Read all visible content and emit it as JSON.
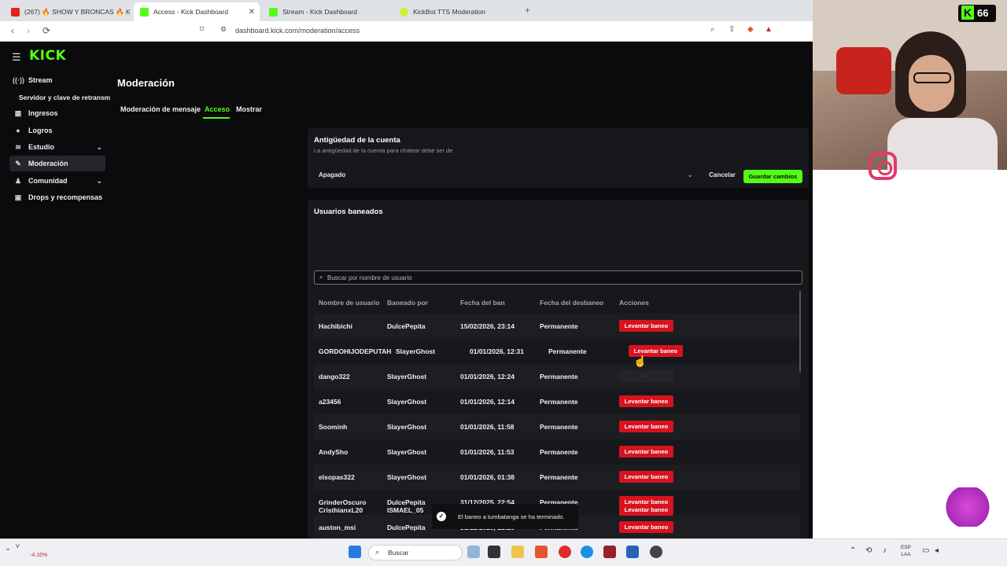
{
  "browser": {
    "tabs": [
      {
        "label": "(267) 🔥 SHOW Y BRONCAS 🔥 KINGT",
        "active": false
      },
      {
        "label": "Access - Kick Dashboard",
        "active": true
      },
      {
        "label": "Stream - Kick Dashboard",
        "active": false
      },
      {
        "label": "KickBot TTS Moderation",
        "active": false
      }
    ],
    "url": "dashboard.kick.com/moderation/access"
  },
  "sidebar": {
    "items": [
      {
        "label": "Stream",
        "icon": "broadcast-icon"
      },
      {
        "label": "Servidor y clave de retransm",
        "icon": ""
      },
      {
        "label": "Ingresos",
        "icon": "chart-icon"
      },
      {
        "label": "Logros",
        "icon": "trophy-icon"
      },
      {
        "label": "Estudio",
        "icon": "layers-icon"
      },
      {
        "label": "Moderación",
        "icon": "wrench-icon"
      },
      {
        "label": "Comunidad",
        "icon": "users-icon"
      },
      {
        "label": "Drops y recompensas",
        "icon": "gift-icon"
      }
    ]
  },
  "page": {
    "title": "Moderación",
    "tabs": [
      "Moderación de mensaje",
      "Acceso",
      "Mostrar"
    ]
  },
  "account_age": {
    "title": "Antigüedad de la cuenta",
    "subtitle": "La antigüedad de la cuenta para chatear debe ser de",
    "value": "Apagado",
    "cancel": "Cancelar",
    "save": "Guardar cambios"
  },
  "bans": {
    "title": "Usuarios baneados",
    "search_placeholder": "Buscar por nombre de usuario",
    "columns": [
      "Nombre de usuario",
      "Baneado por",
      "Fecha del ban",
      "Fecha del desbaneo",
      "Acciones"
    ],
    "unban_label": "Levantar baneo",
    "rows": [
      {
        "user": "Hachibichi",
        "by": "DulcePepita",
        "date": "15/02/2026, 23:14",
        "until": "Permanente"
      },
      {
        "user": "GORDOHIJODEPUTAH",
        "by": "SlayerGhost",
        "date": "01/01/2026, 12:31",
        "until": "Permanente"
      },
      {
        "user": "dango322",
        "by": "SlayerGhost",
        "date": "01/01/2026, 12:24",
        "until": "Permanente"
      },
      {
        "user": "a23456",
        "by": "SlayerGhost",
        "date": "01/01/2026, 12:14",
        "until": "Permanente"
      },
      {
        "user": "Soominh",
        "by": "SlayerGhost",
        "date": "01/01/2026, 11:58",
        "until": "Permanente"
      },
      {
        "user": "AndySho",
        "by": "SlayerGhost",
        "date": "01/01/2026, 11:53",
        "until": "Permanente"
      },
      {
        "user": "elsopas322",
        "by": "SlayerGhost",
        "date": "01/01/2026, 01:38",
        "until": "Permanente"
      },
      {
        "user": "GrinderOscuro",
        "by": "DulcePepita",
        "date": "31/12/2025, 22:54",
        "until": "Permanente"
      },
      {
        "user": "auston_msi",
        "by": "DulcePepita",
        "date": "31/12/2025, 22:29",
        "until": "Permanente"
      },
      {
        "user": "CristhianxL20",
        "by": "ISMAEL_05",
        "date": "",
        "until": ""
      }
    ]
  },
  "toast": {
    "message": "El baneo a tumbatanga se ha terminado."
  },
  "stream_overlay": {
    "kick_viewers": "66"
  },
  "taskbar": {
    "ticker_label": "V",
    "ticker_value": "-4.16%",
    "search_label": "Buscar",
    "lang_top": "ESP",
    "lang_bottom": "LAA"
  },
  "colors": {
    "kick_green": "#53fc18",
    "unban_red": "#d6131f",
    "panel_bg": "#17181c"
  }
}
